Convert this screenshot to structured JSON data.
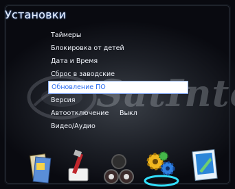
{
  "header": {
    "title": "Установки"
  },
  "watermark": {
    "text": "SatIntegra"
  },
  "menu": {
    "items": [
      {
        "label": "Таймеры"
      },
      {
        "label": "Блокировка от детей"
      },
      {
        "label": "Дата и Время"
      },
      {
        "label": "Сброс в заводские"
      },
      {
        "label": "Обновление ПО",
        "selected": true
      },
      {
        "label": "Версия"
      },
      {
        "label": "Автоотключение",
        "value": "Выкл"
      },
      {
        "label": "Видео/Аудио"
      }
    ]
  },
  "dock": {
    "icons": [
      "media-files-icon",
      "tools-icon",
      "network-icon",
      "settings-gears-icon",
      "games-icon"
    ],
    "selected": "settings-gears-icon"
  },
  "colors": {
    "highlight_bg": "#ffffff",
    "highlight_text": "#2c6df0",
    "text": "#f1f4fb"
  }
}
